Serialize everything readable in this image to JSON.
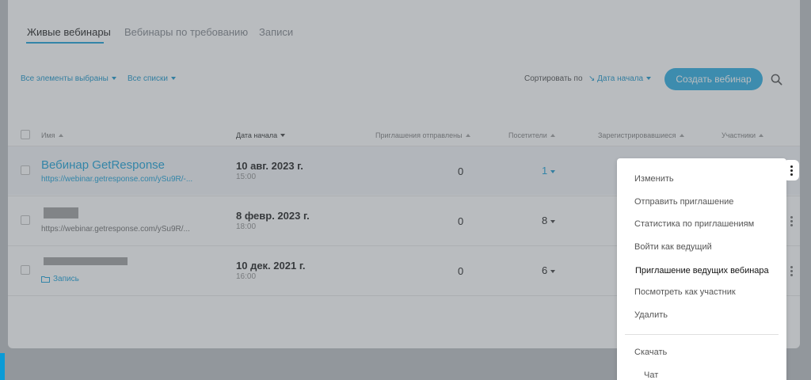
{
  "tabs": [
    {
      "label": "Живые вебинары",
      "active": true
    },
    {
      "label": "Вебинары по требованию",
      "active": false
    },
    {
      "label": "Записи",
      "active": false
    }
  ],
  "filters": {
    "elements": "Все элементы выбраны",
    "lists": "Все списки"
  },
  "sort": {
    "label": "Сортировать по",
    "value": "↘ Дата начала"
  },
  "create_button": "Создать вебинар",
  "columns": {
    "name": "Имя",
    "start_date": "Дата начала",
    "invites_sent": "Приглашения отправлены",
    "visitors": "Посетители",
    "registered": "Зарегистрировавшиеся",
    "participants": "Участники"
  },
  "rows": [
    {
      "title": "Вебинар GetResponse",
      "url": "https://webinar.getresponse.com/ySu9R/-...",
      "date": "10 авг. 2023 г.",
      "time": "15:00",
      "invites": "0",
      "visitors": "1"
    },
    {
      "title": "",
      "url": "https://webinar.getresponse.com/ySu9R/...",
      "date": "8 февр. 2023 г.",
      "time": "18:00",
      "invites": "0",
      "visitors": "8"
    },
    {
      "title": "",
      "url": "Запись",
      "date": "10 дек. 2021 г.",
      "time": "16:00",
      "invites": "0",
      "visitors": "6"
    }
  ],
  "menu": {
    "items": [
      "Изменить",
      "Отправить приглашение",
      "Статистика по приглашениям",
      "Войти как ведущий",
      "Приглашение ведущих вебинара",
      "Посмотреть как участник",
      "Удалить",
      "Скачать",
      "Чат"
    ]
  },
  "colors": {
    "accent": "#1ea8e0",
    "link": "#0b9bd6"
  }
}
